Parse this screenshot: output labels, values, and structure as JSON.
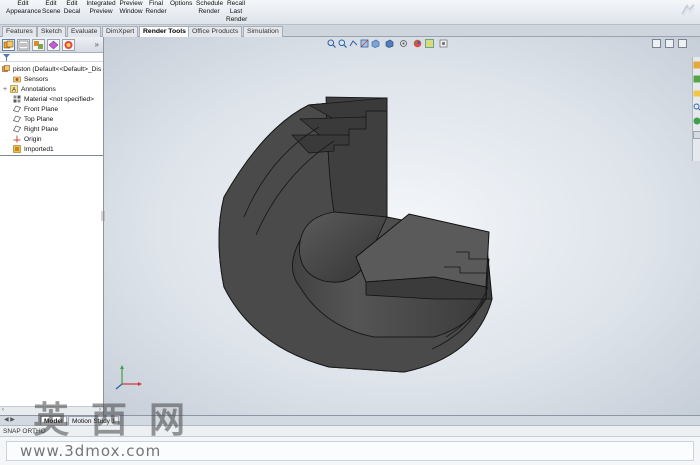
{
  "ribbon": {
    "items": [
      {
        "label": "Edit\nAppearance"
      },
      {
        "label": "Edit\nScene"
      },
      {
        "label": "Edit\nDecal"
      },
      {
        "label": "Integrated\nPreview"
      },
      {
        "label": "Preview\nWindow"
      },
      {
        "label": "Final\nRender"
      },
      {
        "label": "Options"
      },
      {
        "label": "Schedule\nRender"
      },
      {
        "label": "Recall\nLast\nRender"
      }
    ]
  },
  "tabs": [
    {
      "label": "Features"
    },
    {
      "label": "Sketch"
    },
    {
      "label": "Evaluate"
    },
    {
      "label": "DimXpert"
    },
    {
      "label": "Render Tools"
    },
    {
      "label": "Office Products"
    },
    {
      "label": "Simulation"
    }
  ],
  "active_tab": "Render Tools",
  "tree": {
    "root": "piston  (Default<<Default>_Dis",
    "items": [
      {
        "label": "Sensors",
        "icon": "sensor-icon"
      },
      {
        "label": "Annotations",
        "icon": "annotation-icon"
      },
      {
        "label": "Material <not specified>",
        "icon": "material-icon"
      },
      {
        "label": "Front Plane",
        "icon": "plane-icon"
      },
      {
        "label": "Top Plane",
        "icon": "plane-icon"
      },
      {
        "label": "Right Plane",
        "icon": "plane-icon"
      },
      {
        "label": "Origin",
        "icon": "origin-icon"
      },
      {
        "label": "Imported1",
        "icon": "imported-body-icon"
      }
    ]
  },
  "bottom_tabs": [
    {
      "label": "Model"
    },
    {
      "label": "Motion Study 1"
    }
  ],
  "status": {
    "text": "SNAP  ORTHO"
  },
  "watermark": {
    "title": "英西网",
    "url": "www.3dmox.com"
  },
  "colors": {
    "model_fill": "#4a4a4a",
    "model_edge": "#1a1a1a",
    "active_tab": "#ffffff"
  }
}
